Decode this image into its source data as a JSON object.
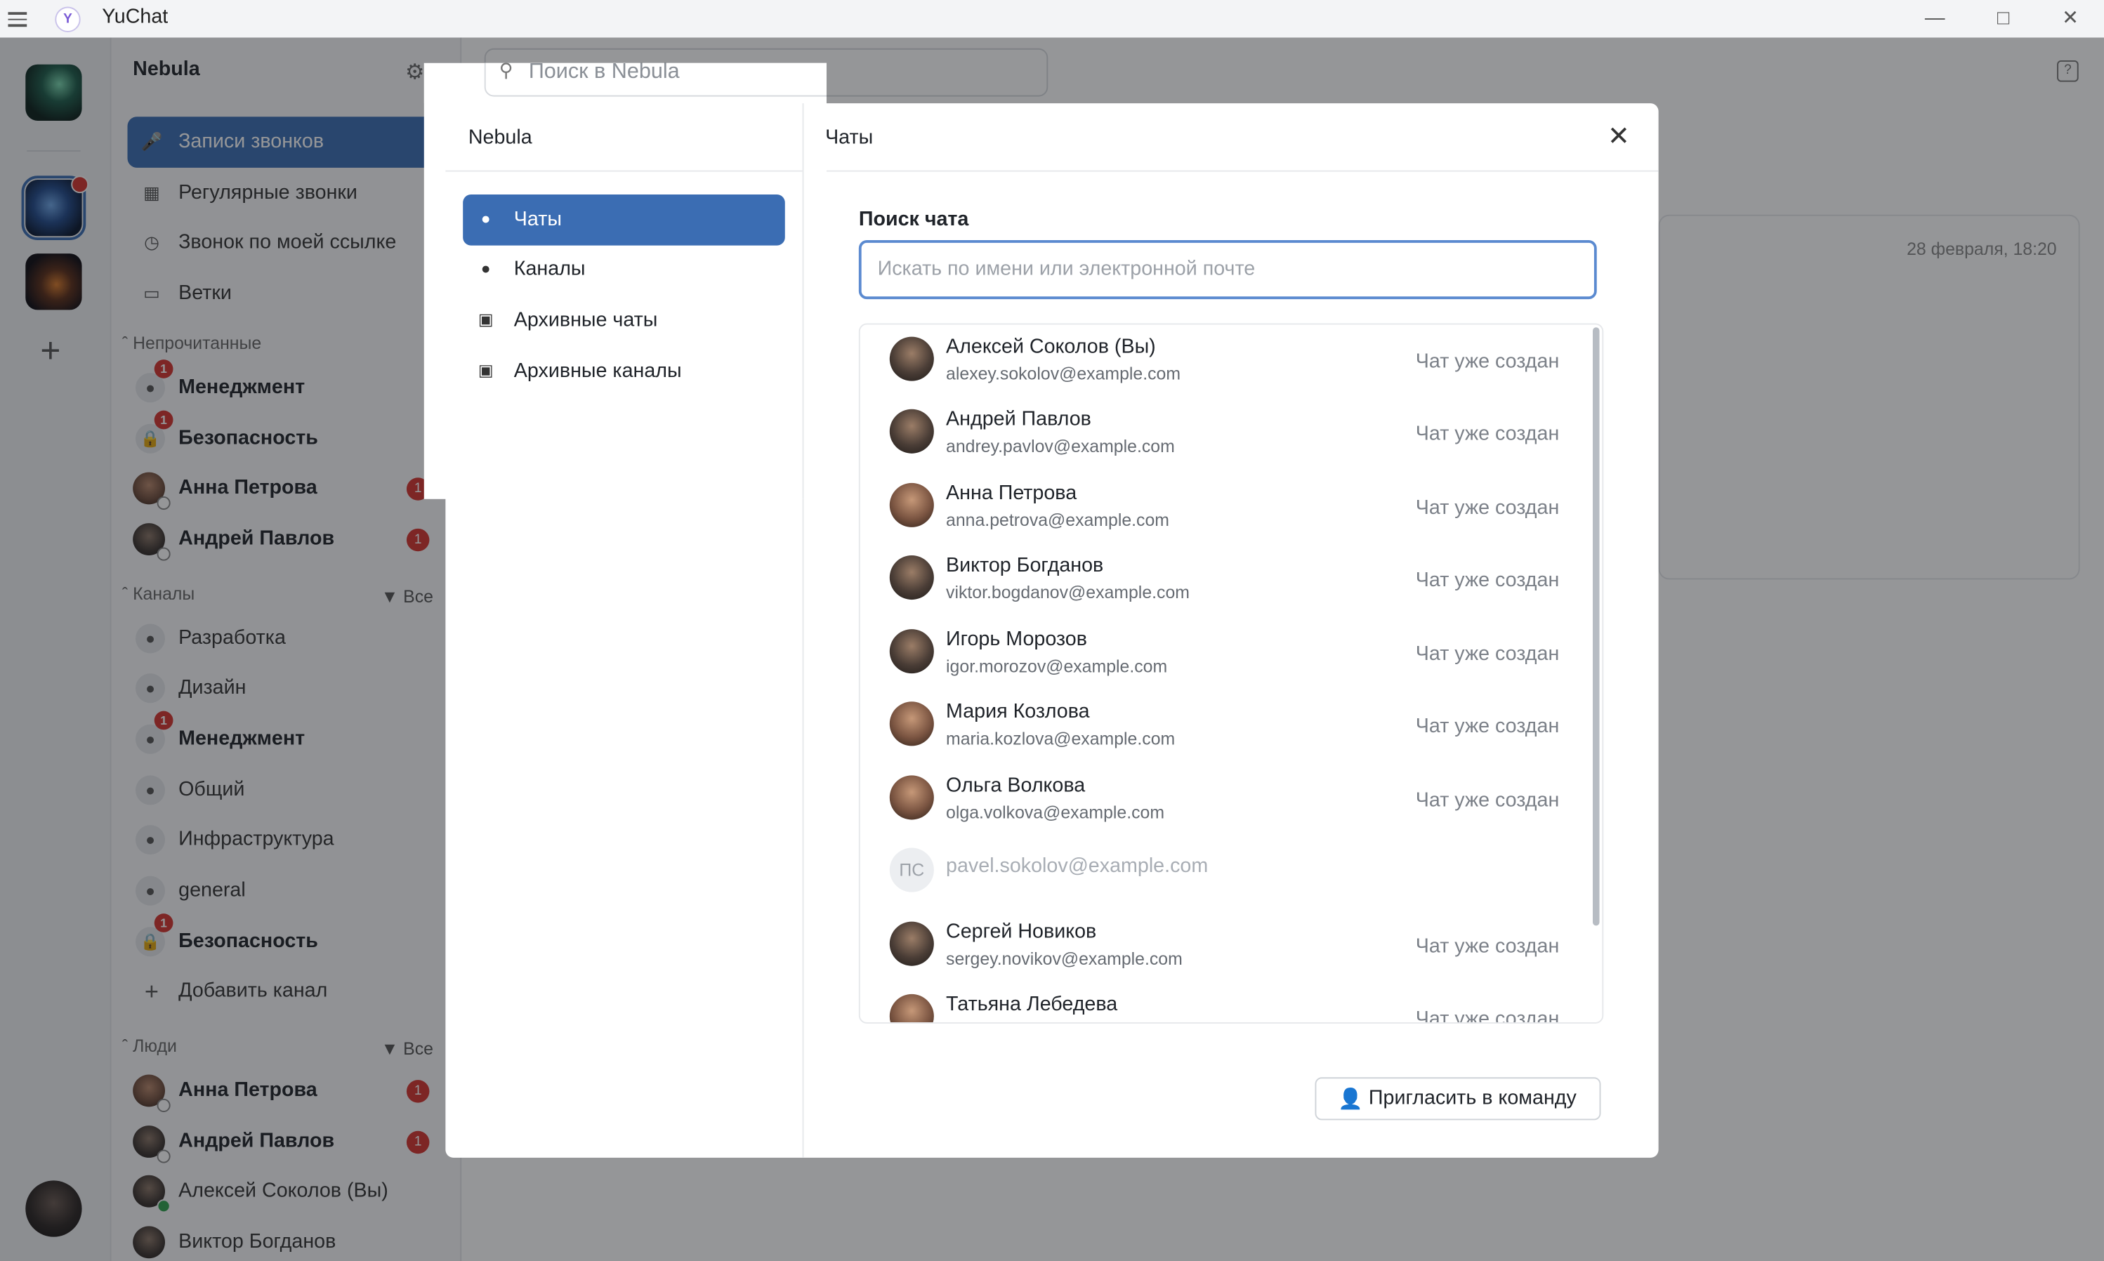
{
  "app": {
    "title": "YuChat"
  },
  "sidebar": {
    "workspace_name": "Nebula",
    "top_items": [
      {
        "label": "Записи звонков",
        "icon": "mic-icon"
      },
      {
        "label": "Регулярные звонки",
        "icon": "calendar-icon"
      },
      {
        "label": "Звонок по моей ссылке",
        "icon": "clock-icon"
      },
      {
        "label": "Ветки",
        "icon": "thread-icon"
      }
    ],
    "unread_header": "Непрочитанные",
    "unread": [
      {
        "label": "Менеджмент",
        "badge": "1"
      },
      {
        "label": "Безопасность",
        "badge": "1"
      },
      {
        "label": "Анна Петрова",
        "badge": "1"
      },
      {
        "label": "Андрей Павлов",
        "badge": "1"
      }
    ],
    "channels_header": "Каналы",
    "channels_filter": "Все",
    "channels": [
      {
        "label": "Разработка"
      },
      {
        "label": "Дизайн"
      },
      {
        "label": "Менеджмент",
        "badge": "1"
      },
      {
        "label": "Общий"
      },
      {
        "label": "Инфраструктура"
      },
      {
        "label": "general"
      },
      {
        "label": "Безопасность",
        "badge": "1"
      }
    ],
    "add_channel": "Добавить канал",
    "people_header": "Люди",
    "people_filter": "Все",
    "people": [
      {
        "label": "Анна Петрова",
        "badge": "1"
      },
      {
        "label": "Андрей Павлов",
        "badge": "1"
      },
      {
        "label": "Алексей Соколов (Вы)"
      },
      {
        "label": "Виктор Богданов"
      }
    ]
  },
  "main": {
    "search_placeholder": "Поиск в Nebula",
    "date": "28 февраля, 18:20"
  },
  "modal": {
    "left_title": "Nebula",
    "nav": [
      {
        "label": "Чаты",
        "icon": "person-icon"
      },
      {
        "label": "Каналы",
        "icon": "person-icon"
      },
      {
        "label": "Архивные чаты",
        "icon": "archive-icon"
      },
      {
        "label": "Архивные каналы",
        "icon": "archive-icon"
      }
    ],
    "title": "Чаты",
    "search_label": "Поиск чата",
    "search_placeholder": "Искать по имени или электронной почте",
    "contacts": [
      {
        "name": "Алексей Соколов (Вы)",
        "email": "alexey.sokolov@example.com",
        "status": "Чат уже создан"
      },
      {
        "name": "Андрей Павлов",
        "email": "andrey.pavlov@example.com",
        "status": "Чат уже создан"
      },
      {
        "name": "Анна Петрова",
        "email": "anna.petrova@example.com",
        "status": "Чат уже создан"
      },
      {
        "name": "Виктор Богданов",
        "email": "viktor.bogdanov@example.com",
        "status": "Чат уже создан"
      },
      {
        "name": "Игорь Морозов",
        "email": "igor.morozov@example.com",
        "status": "Чат уже создан"
      },
      {
        "name": "Мария Козлова",
        "email": "maria.kozlova@example.com",
        "status": "Чат уже создан"
      },
      {
        "name": "Ольга Волкова",
        "email": "olga.volkova@example.com",
        "status": "Чат уже создан"
      },
      {
        "initials": "ПС",
        "email": "pavel.sokolov@example.com"
      },
      {
        "name": "Сергей Новиков",
        "email": "sergey.novikov@example.com",
        "status": "Чат уже создан"
      },
      {
        "name": "Татьяна Лебедева",
        "status": "Чат уже создан"
      }
    ],
    "invite_button": "Пригласить в команду"
  }
}
